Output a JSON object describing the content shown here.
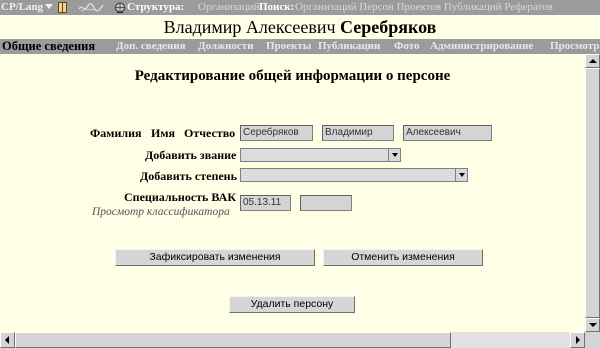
{
  "topbar": {
    "lang": "CP/Lang",
    "structure_label": "Структура:",
    "structure_link": "Организаций",
    "search_label": "Поиск:",
    "search_links": "Организаций Персон Проектов Публикаций Рефератов"
  },
  "person": {
    "first_middle": "Владимир Алексеевич",
    "last": "Серебряков"
  },
  "tabs": [
    {
      "label": "Общие сведения",
      "active": true
    },
    {
      "label": "Доп. сведения",
      "active": false
    },
    {
      "label": "Должности",
      "active": false
    },
    {
      "label": "Проекты",
      "active": false
    },
    {
      "label": "Публикации",
      "active": false
    },
    {
      "label": "Фото",
      "active": false
    },
    {
      "label": "Администрирование",
      "active": false
    },
    {
      "label": "Просмотр",
      "active": false
    }
  ],
  "page": {
    "heading": "Редактирование общей информации о персоне"
  },
  "form": {
    "label_lastname": "Фамилия",
    "label_firstname": "Имя",
    "label_middlename": "Отчество",
    "lastname": "Серебряков",
    "firstname": "Владимир",
    "middlename": "Алексеевич",
    "label_add_rank": "Добавить звание",
    "label_add_degree": "Добавить степень",
    "label_vak": "Специальность ВАК",
    "classifier_link": "Просмотр классификатора",
    "vak_code": "05.13.11",
    "vak_extra": ""
  },
  "buttons": {
    "commit": "Зафиксировать изменения",
    "cancel": "Отменить изменения",
    "delete": "Удалить персону"
  },
  "colors": {
    "page_bg": "#ffffe5",
    "bar_bg": "#9b9b9b",
    "field_bg": "#d4d4d4"
  }
}
